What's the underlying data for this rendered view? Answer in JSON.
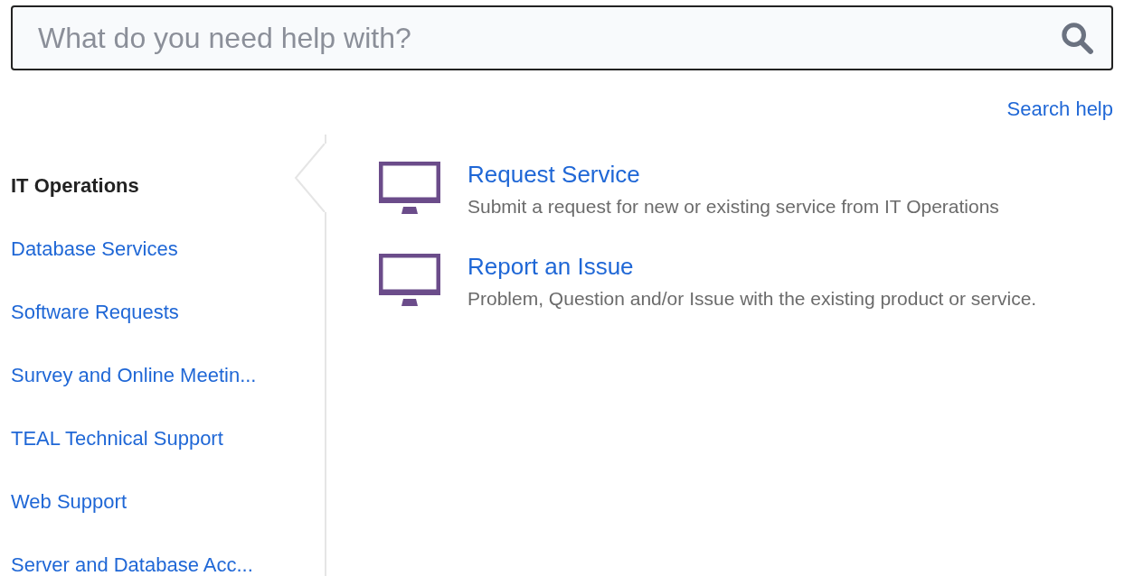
{
  "search": {
    "placeholder": "What do you need help with?"
  },
  "search_help": "Search help",
  "sidebar": {
    "items": [
      {
        "label": "IT Operations",
        "selected": true
      },
      {
        "label": "Database Services",
        "selected": false
      },
      {
        "label": "Software Requests",
        "selected": false
      },
      {
        "label": "Survey and Online Meetin...",
        "selected": false
      },
      {
        "label": "TEAL Technical Support",
        "selected": false
      },
      {
        "label": "Web Support",
        "selected": false
      },
      {
        "label": "Server and Database Acc...",
        "selected": false
      }
    ]
  },
  "request_types": [
    {
      "title": "Request Service",
      "description": "Submit a request for new or existing service from IT Operations"
    },
    {
      "title": "Report an Issue",
      "description": "Problem, Question and/or Issue with the existing product or service."
    }
  ]
}
